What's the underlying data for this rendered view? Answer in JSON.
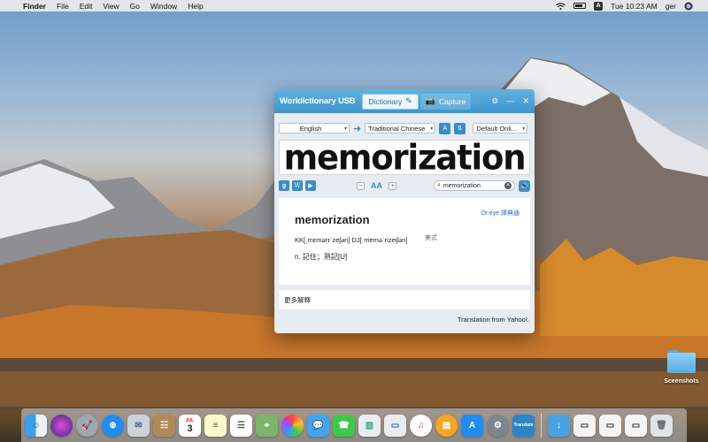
{
  "menubar": {
    "app_name": "Finder",
    "menus": [
      "File",
      "Edit",
      "View",
      "Go",
      "Window",
      "Help"
    ],
    "ime_label": "A",
    "clock": "Tue 10:23 AM",
    "user": "ger"
  },
  "window": {
    "app_title": "Worldictionary USB",
    "tabs": {
      "dictionary": "Dictionary",
      "capture": "Capture"
    },
    "source_language": "English",
    "target_language": "Traditional Chinese",
    "engine": "Default Onli...",
    "captured_word": "memorization",
    "search_value": "memorization",
    "zoom_label": "AA",
    "result": {
      "headword": "memorization",
      "source_link": "Dr.eye 譯典通",
      "accent_label": "美式",
      "phonetic": "KK[ˌmɛmərɪˈzeʃən]   DJ[ˌmeməˈrizeiʃən]",
      "definition": "n.   記住；熟記[U]"
    },
    "more_link": "更多解釋",
    "footer": "Translation from Yahoo!."
  },
  "desktop": {
    "folder_label": "Sceenshots"
  },
  "dock": {
    "calendar_day": "3",
    "calendar_month": "JUL",
    "translate_label": "Translate"
  },
  "colors": {
    "accent": "#3a8cc8",
    "titlebar": "#4aa0d6",
    "link": "#2a6bd1"
  }
}
